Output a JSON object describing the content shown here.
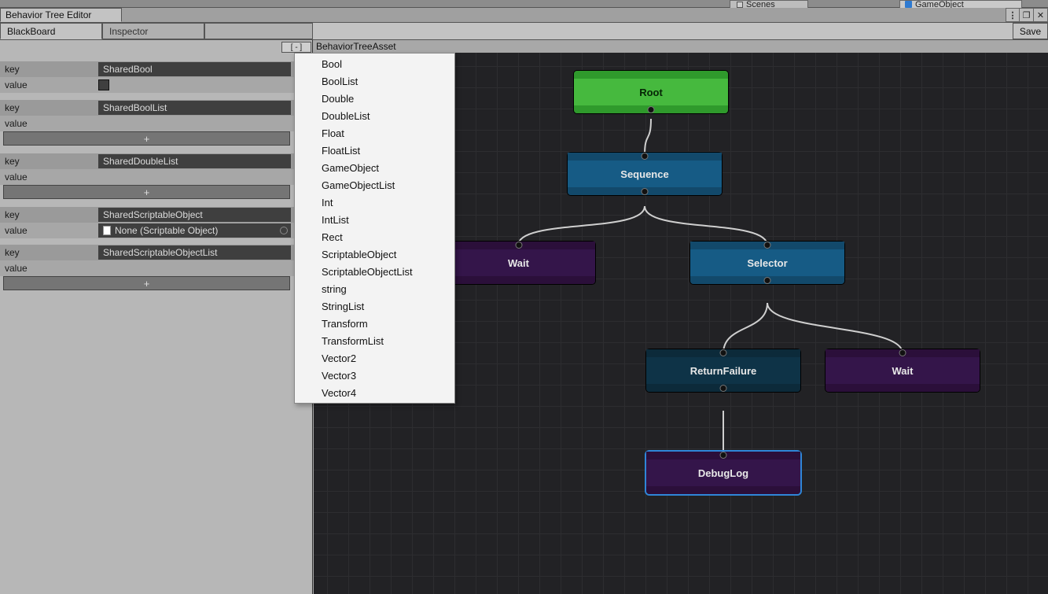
{
  "topTabs": {
    "scenes": "Scenes",
    "gameObject": "GameObject"
  },
  "window": {
    "title": "Behavior Tree Editor",
    "buttons": {
      "more": "⋮",
      "restore": "❐",
      "close": "✕"
    }
  },
  "innerTabs": {
    "blackboard": "BlackBoard",
    "inspector": "Inspector",
    "save": "Save"
  },
  "asset": {
    "label": "BehaviorTreeAsset",
    "toggle": "[ - ]"
  },
  "blackboard": {
    "keyLabel": "key",
    "valueLabel": "value",
    "plus": "+",
    "entries": [
      {
        "name": "SharedBool",
        "valueType": "checkbox"
      },
      {
        "name": "SharedBoolList",
        "valueType": "list"
      },
      {
        "name": "SharedDoubleList",
        "valueType": "list"
      },
      {
        "name": "SharedScriptableObject",
        "valueType": "none",
        "noneText": "None (Scriptable Object)"
      },
      {
        "name": "SharedScriptableObjectList",
        "valueType": "list"
      }
    ]
  },
  "contextMenu": {
    "items": [
      "Bool",
      "BoolList",
      "Double",
      "DoubleList",
      "Float",
      "FloatList",
      "GameObject",
      "GameObjectList",
      "Int",
      "IntList",
      "Rect",
      "ScriptableObject",
      "ScriptableObjectList",
      "string",
      "StringList",
      "Transform",
      "TransformList",
      "Vector2",
      "Vector3",
      "Vector4"
    ]
  },
  "nodes": {
    "root": "Root",
    "sequence": "Sequence",
    "wait": "Wait",
    "selector": "Selector",
    "returnFailure": "ReturnFailure",
    "wait2": "Wait",
    "debugLog": "DebugLog"
  }
}
